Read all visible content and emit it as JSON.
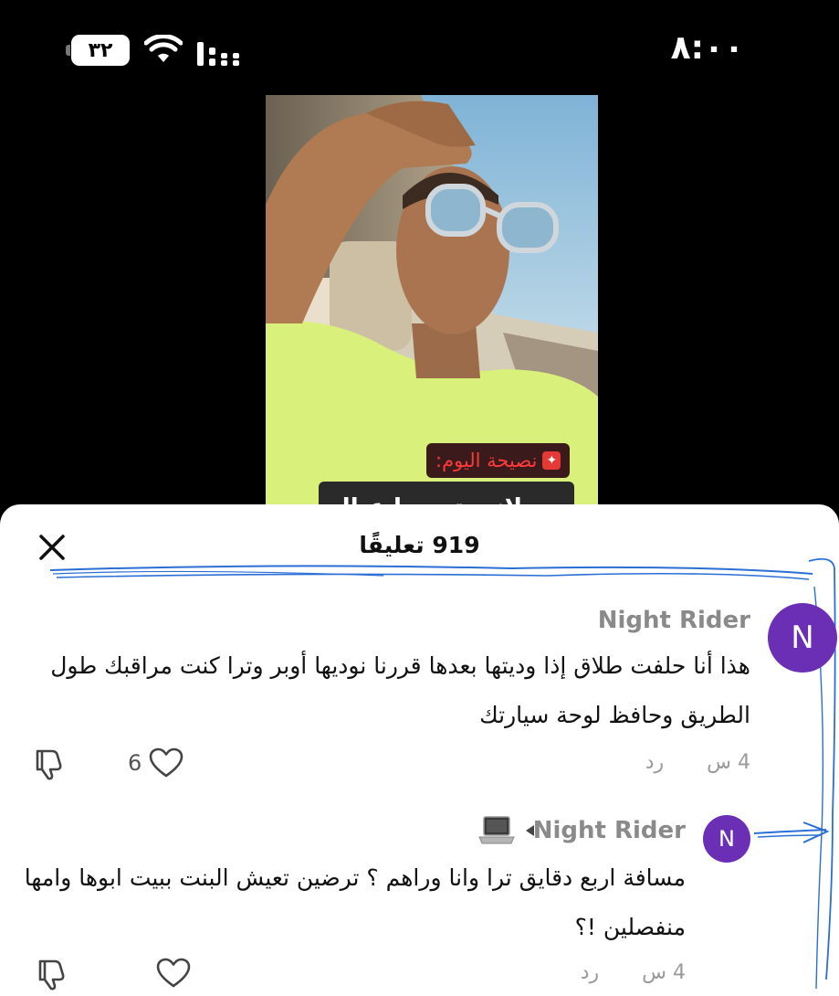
{
  "status_bar": {
    "time": "٨:٠٠",
    "battery_level": "٣٢",
    "icons": [
      "battery-icon",
      "wifi-icon",
      "cellular-signal-icon"
    ]
  },
  "video": {
    "tip_label": "نصيحة اليوم:",
    "caption_partial": "مع لاني تحييها عيال"
  },
  "comments_sheet": {
    "count": "919",
    "count_label": "تعليقًا",
    "close_icon": "close-icon"
  },
  "comments": [
    {
      "author": "Night Rider",
      "avatar_letter": "N",
      "text": "هذا أنا حلفت طلاق إذا وديتها بعدها قررنا نوديها أوبر وترا كنت مراقبك طول الطريق وحافظ لوحة سيارتك",
      "time": "4 س",
      "reply_label": "رد",
      "likes": "6"
    },
    {
      "author": "Night Rider",
      "avatar_letter": "N",
      "reply_to_icon": "laptop-icon",
      "text": "مسافة اربع دقايق ترا وانا وراهم ؟ ترضين تعيش البنت ببيت ابوها وامها منفصلين !؟",
      "time": "4 س",
      "reply_label": "رد",
      "likes": ""
    }
  ],
  "colors": {
    "avatar": "#6a2fb5",
    "scribble": "#2b6fd6",
    "tip_text": "#ff3a3a"
  }
}
